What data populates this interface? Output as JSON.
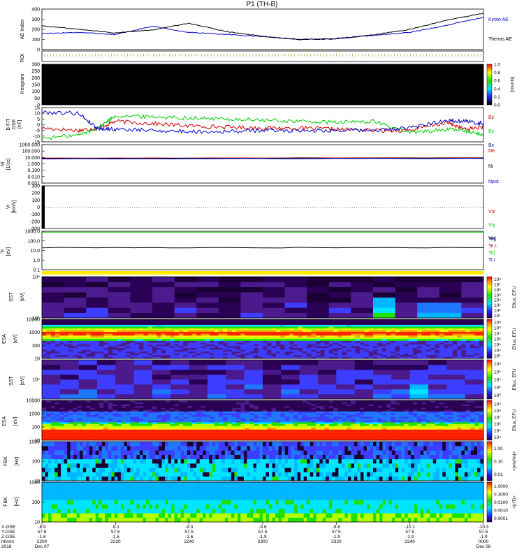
{
  "chart_data": {
    "type": "line",
    "title": "P1 (TH-B)",
    "xlim": [
      "22:00",
      "00:00"
    ],
    "panels": [
      {
        "id": "ae",
        "ylabel": "AE Index",
        "unit": "",
        "scale": "linear",
        "ylim": [
          0,
          400
        ],
        "yticks": [
          "0",
          "100",
          "200",
          "300",
          "400"
        ],
        "series": [
          {
            "name": "Kyoto AE",
            "color": "#0000cc",
            "x": [
              0,
              10,
              20,
              30,
              40,
              50,
              60,
              70,
              80,
              90,
              100,
              110,
              120
            ],
            "y": [
              160,
              170,
              150,
              230,
              170,
              150,
              130,
              100,
              110,
              140,
              170,
              240,
              320
            ]
          },
          {
            "name": "Themis AE",
            "color": "#000000",
            "x": [
              0,
              10,
              20,
              30,
              40,
              50,
              60,
              70,
              80,
              90,
              100,
              110,
              120
            ],
            "y": [
              235,
              200,
              165,
              195,
              260,
              180,
              130,
              100,
              105,
              145,
              200,
              290,
              360
            ]
          }
        ]
      },
      {
        "id": "roi",
        "ylabel": "ROI",
        "unit": "",
        "scale": "linear",
        "yticks": []
      },
      {
        "id": "keogram",
        "ylabel": "Keogram",
        "unit": "",
        "scale": "linear",
        "ylim": [
          0,
          300
        ],
        "yticks": [
          "0",
          "50",
          "100",
          "150",
          "200",
          "250",
          "300"
        ],
        "colorbar": {
          "label": "[counts]",
          "ticks": [
            "0.0",
            "0.2",
            "0.4",
            "0.6",
            "0.8",
            "1.0"
          ]
        }
      },
      {
        "id": "bfield",
        "ylabel": "B FIT",
        "unit": "[nT]",
        "coord": "GSE",
        "scale": "linear",
        "ylim": [
          -15,
          15
        ],
        "yticks": [
          "-15",
          "-10",
          "-5",
          "0",
          "5",
          "10",
          "15"
        ],
        "series": [
          {
            "name": "Bz",
            "color": "#cc0000",
            "x": [
              0,
              10,
              15,
              20,
              30,
              40,
              50,
              60,
              70,
              80,
              90,
              100,
              110,
              115,
              120
            ],
            "y": [
              -3,
              -5,
              -3,
              3,
              1,
              -1,
              -2,
              -3,
              -3,
              -4,
              -5,
              -5,
              2,
              -4,
              -2
            ]
          },
          {
            "name": "By",
            "color": "#00cc00",
            "x": [
              0,
              10,
              15,
              20,
              30,
              40,
              50,
              60,
              70,
              80,
              90,
              100,
              110,
              115,
              120
            ],
            "y": [
              -12,
              -9,
              -3,
              8,
              7,
              6,
              5,
              4,
              3,
              2,
              3,
              -7,
              -4,
              -5,
              -9
            ]
          },
          {
            "name": "Bx",
            "color": "#0000cc",
            "x": [
              0,
              10,
              15,
              20,
              30,
              40,
              50,
              60,
              70,
              80,
              90,
              100,
              110,
              115,
              120
            ],
            "y": [
              11,
              10,
              -3,
              -4,
              -5,
              -6,
              -6,
              -5,
              -5,
              -5,
              -5,
              -3,
              4,
              3,
              1
            ]
          }
        ]
      },
      {
        "id": "density",
        "ylabel": "Ni",
        "unit": "[1/cc]",
        "scale": "log",
        "ylim": [
          0.001,
          1000
        ],
        "yticks": [
          "0.001",
          "0.010",
          "0.100",
          "1.000",
          "10.000",
          "100.000",
          "1000.000"
        ],
        "series": [
          {
            "name": "Ne",
            "color": "#cc0000",
            "x": [
              0,
              120
            ],
            "y": [
              8,
              9
            ]
          },
          {
            "name": "Ni",
            "color": "#000000",
            "x": [
              0,
              120
            ],
            "y": [
              7,
              8
            ]
          },
          {
            "name": "Npot",
            "color": "#0000cc",
            "x": [
              0,
              120
            ],
            "y": [
              6,
              7
            ]
          }
        ]
      },
      {
        "id": "velocity",
        "ylabel": "Vi",
        "unit": "[km/s]",
        "scale": "linear",
        "ylim": [
          -300,
          300
        ],
        "yticks": [
          "-300",
          "-200",
          "-100",
          "0",
          "100",
          "200",
          "300"
        ],
        "series": [
          {
            "name": "Viz",
            "color": "#cc0000",
            "x": [],
            "y": []
          },
          {
            "name": "Viy",
            "color": "#00cc00",
            "x": [],
            "y": []
          },
          {
            "name": "Vix",
            "color": "#0000cc",
            "x": [],
            "y": []
          }
        ]
      },
      {
        "id": "temperature",
        "ylabel": "Ti",
        "unit": "[eV]",
        "scale": "log",
        "ylim": [
          0.1,
          1000
        ],
        "yticks": [
          "0.1",
          "1.0",
          "10.0",
          "100.0",
          "1000.0"
        ],
        "series": [
          {
            "name": "Te||",
            "color": "#000000",
            "x": [
              0,
              120
            ],
            "y": [
              20,
              20
            ]
          },
          {
            "name": "Te⊥",
            "color": "#cc0000",
            "x": [],
            "y": []
          },
          {
            "name": "Ti||",
            "color": "#00cc00",
            "x": [
              0,
              120
            ],
            "y": [
              800,
              800
            ]
          },
          {
            "name": "Ti⊥",
            "color": "#0000cc",
            "x": [],
            "y": []
          }
        ]
      },
      {
        "id": "sst_e",
        "ylabel": "SST",
        "unit": "[eV]",
        "scale": "log",
        "yticks": [
          "10^5",
          "10^6"
        ],
        "colorbar": {
          "label": "Eflux, EFU",
          "ticks": [
            "10^1",
            "10^2",
            "10^3",
            "10^4",
            "10^5",
            "10^6",
            "10^7",
            "10^8"
          ]
        }
      },
      {
        "id": "esa_e",
        "ylabel": "ESA",
        "unit": "[eV]",
        "scale": "log",
        "yticks": [
          "10",
          "100",
          "1000",
          "10000"
        ],
        "colorbar": {
          "label": "Eflux, EFU",
          "ticks": [
            "10^3",
            "10^4",
            "10^5",
            "10^6",
            "10^7",
            "10^8",
            "10^9"
          ]
        }
      },
      {
        "id": "sst_i",
        "ylabel": "SST",
        "unit": "[eV]",
        "scale": "log",
        "yticks": [
          "10^5"
        ],
        "colorbar": {
          "label": "Eflux, EFU",
          "ticks": [
            "10^0",
            "10^2",
            "10^4",
            "10^6",
            "10^8"
          ]
        }
      },
      {
        "id": "esa_i",
        "ylabel": "ESA",
        "unit": "[eV]",
        "scale": "log",
        "yticks": [
          "10",
          "100",
          "1000",
          "10000"
        ],
        "colorbar": {
          "label": "Eflux, EFU",
          "ticks": [
            "10^4",
            "10^5",
            "10^6",
            "10^7",
            "10^8",
            "10^9"
          ]
        }
      },
      {
        "id": "fbk_scm",
        "ylabel": "FBK",
        "unit": "[Hz]",
        "scale": "log",
        "yticks": [
          "10",
          "100",
          "1000"
        ],
        "colorbar": {
          "label": "<|mV/m|>",
          "ticks": [
            "0.01",
            "0.10",
            "1.00"
          ]
        }
      },
      {
        "id": "fbk_efi",
        "ylabel": "FBK",
        "unit": "[Hz]",
        "scale": "log",
        "yticks": [
          "10",
          "100",
          "1000"
        ],
        "colorbar": {
          "label": "<|nT|>",
          "ticks": [
            "0.0001",
            "0.0010",
            "0.0100",
            "0.1000",
            "1.0000"
          ]
        }
      }
    ],
    "time_axis": {
      "row_labels": [
        "X-GSE",
        "Y-GSE",
        "Z-GSE",
        "hhmm",
        "2018"
      ],
      "columns": [
        {
          "x": 0,
          "values": [
            "-8.9",
            "57.6",
            "-1.6",
            "2200"
          ],
          "date": "Dec 07"
        },
        {
          "x": 20,
          "values": [
            "-9.1",
            "57.6",
            "-1.6",
            "2220"
          ],
          "date": ""
        },
        {
          "x": 40,
          "values": [
            "-9.3",
            "57.5",
            "-1.6",
            "2240"
          ],
          "date": ""
        },
        {
          "x": 60,
          "values": [
            "-9.6",
            "57.5",
            "-1.9",
            "2300"
          ],
          "date": ""
        },
        {
          "x": 80,
          "values": [
            "-9.8",
            "57.5",
            "-1.9",
            "2320"
          ],
          "date": ""
        },
        {
          "x": 100,
          "values": [
            "-10.1",
            "57.5",
            "-1.9",
            "2340"
          ],
          "date": ""
        },
        {
          "x": 120,
          "values": [
            "-10.3",
            "57.5",
            "-1.9",
            "0000"
          ],
          "date": "Dec 08"
        }
      ]
    }
  }
}
